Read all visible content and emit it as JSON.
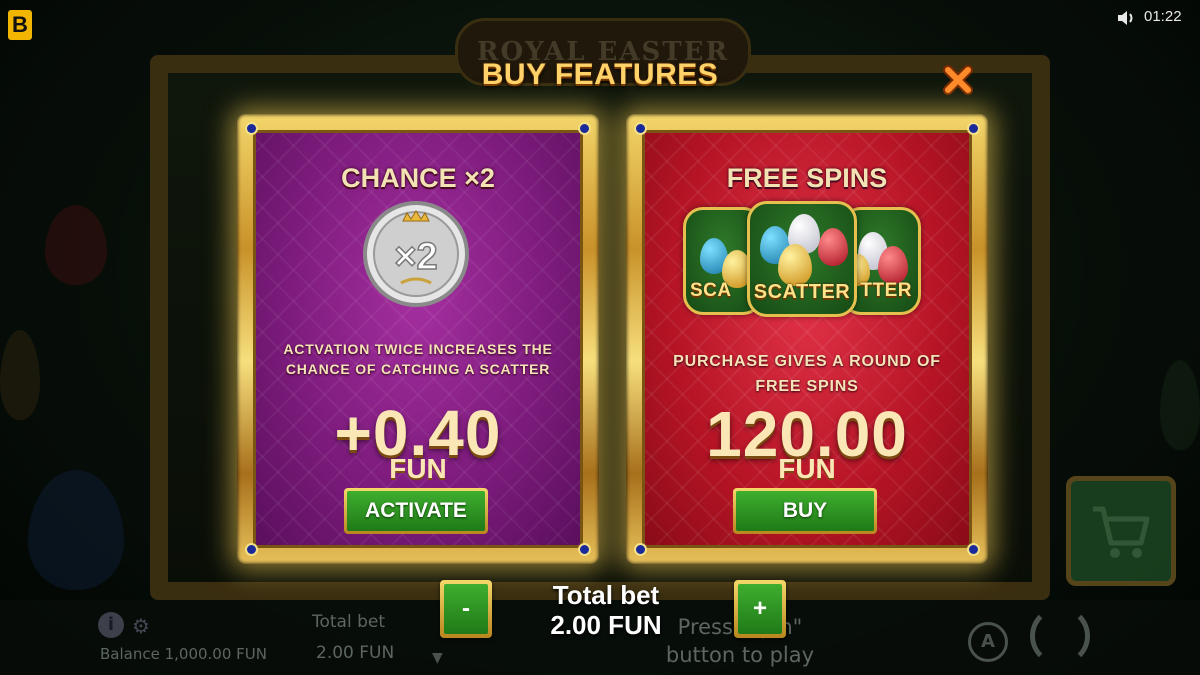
{
  "background": {
    "logo_text": "ROYAL EASTER",
    "balance": "Balance 1,000.00 FUN",
    "total_bet_label": "Total bet",
    "total_bet_value": "2.00 FUN",
    "press_hint": "Press \"spin\" button to play",
    "auto_label": "A"
  },
  "brand": {
    "logo_letter": "B"
  },
  "status": {
    "time": "01:22",
    "sound_icon": "speaker-icon"
  },
  "modal": {
    "title": "BUY FEATURES",
    "close_icon": "close-icon",
    "cards": [
      {
        "title": "CHANCE ×2",
        "coin_text": "×2",
        "description": "ACTVATION TWICE INCREASES THE CHANCE OF CATCHING A SCATTER",
        "price": "+0.40",
        "currency": "FUN",
        "button_label": "ACTIVATE",
        "theme_color": "#8a1f87"
      },
      {
        "title": "FREE SPINS",
        "scatter_label": "SCATTER",
        "scatter_label_left": "SCA",
        "scatter_label_right": "TTER",
        "description": "PURCHASE GIVES A ROUND OF FREE SPINS",
        "price": "120.00",
        "currency": "FUN",
        "button_label": "BUY",
        "theme_color": "#c0182b"
      }
    ]
  },
  "bet": {
    "label": "Total bet",
    "value": "2.00 FUN",
    "decrease_label": "-",
    "increase_label": "+"
  },
  "colors": {
    "gold": "#f3d66a",
    "button_green": "#2f9a25",
    "title_gold": "#ffd36a",
    "close_orange": "#f07a1a"
  }
}
